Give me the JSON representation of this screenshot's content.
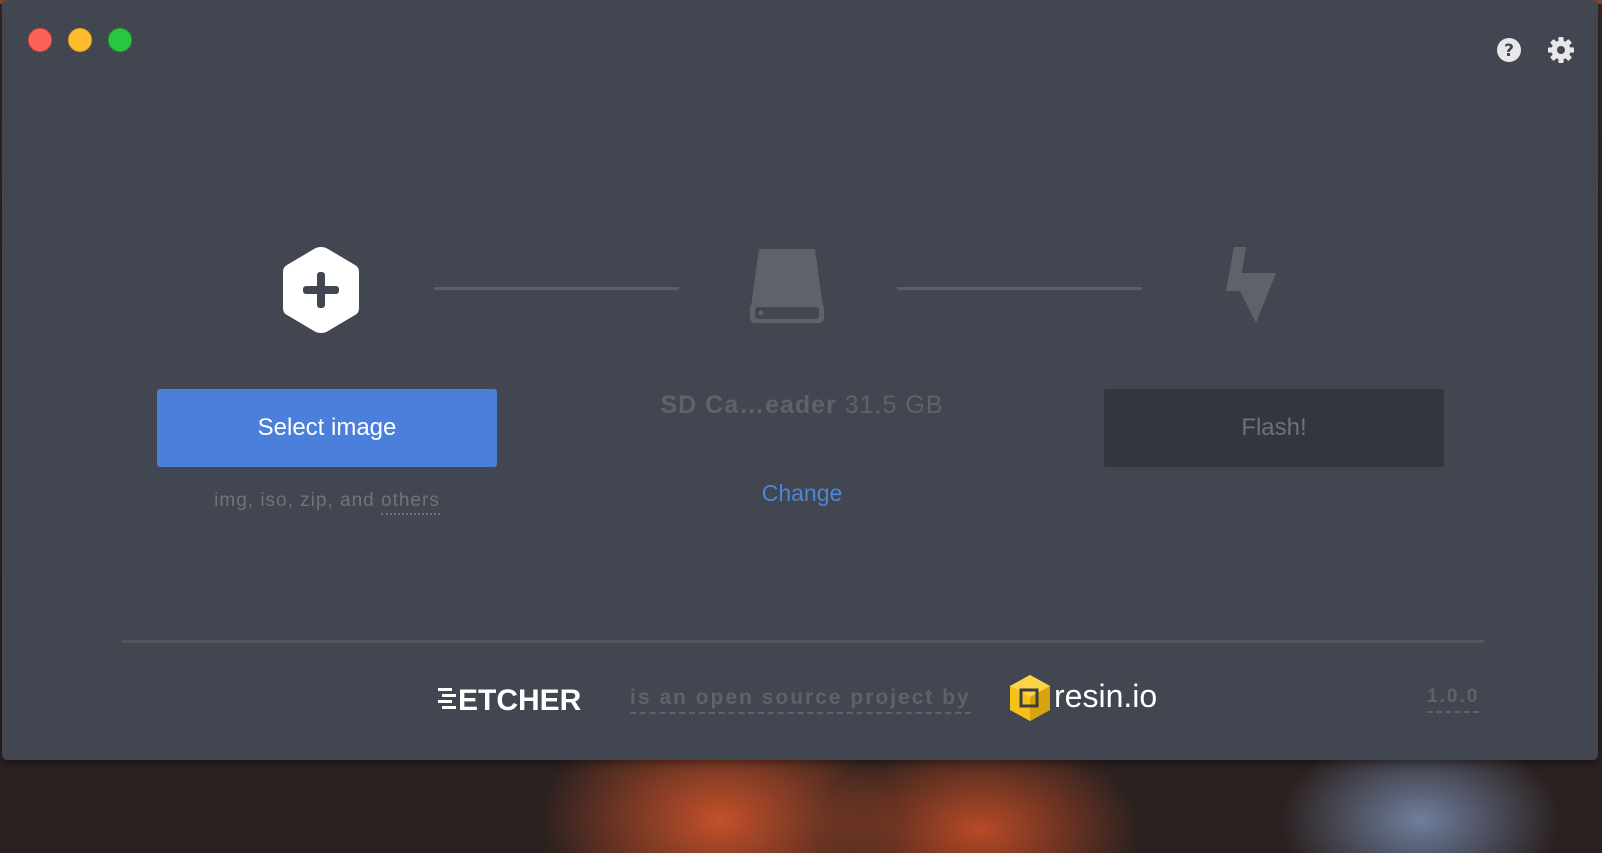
{
  "window": {
    "controls": {
      "close": "close",
      "minimize": "minimize",
      "maximize": "maximize"
    }
  },
  "header": {
    "help_icon": "help-icon",
    "settings_icon": "gear-icon"
  },
  "steps": {
    "image": {
      "icon": "add-image-icon",
      "button_label": "Select image",
      "hint_prefix": "img, iso, zip, and",
      "hint_link": "others"
    },
    "drive": {
      "icon": "drive-icon",
      "name": "SD Ca…eader",
      "size": "31.5 GB",
      "change_label": "Change"
    },
    "flash": {
      "icon": "flash-icon",
      "button_label": "Flash!"
    }
  },
  "footer": {
    "brand": "ETCHER",
    "tagline": "is an open source project by",
    "company": "resin.io",
    "version": "1.0.0"
  },
  "colors": {
    "window_bg": "#424650",
    "accent": "#4a7fdc",
    "link": "#4a87dc",
    "disabled_button": "#34363d",
    "muted_text": "#5e626b"
  }
}
